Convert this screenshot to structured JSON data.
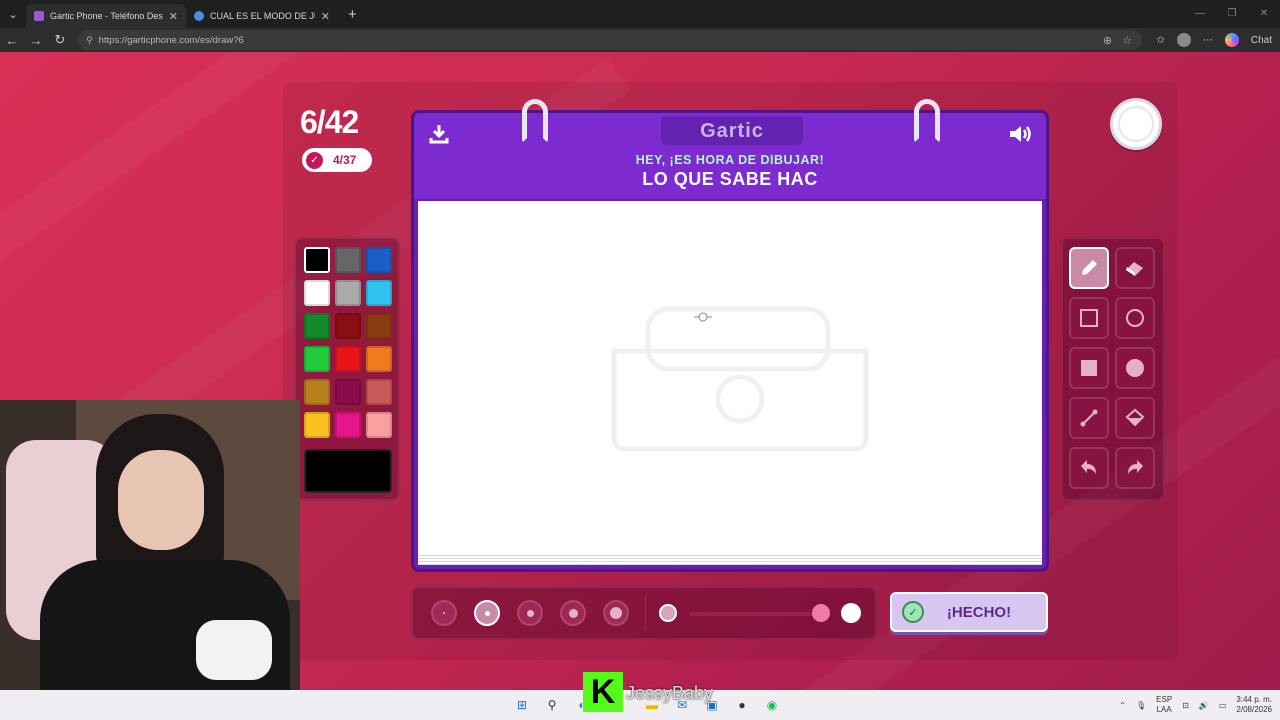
{
  "browser": {
    "tabs": [
      {
        "title": "Gartic Phone - Teléfono Descomp",
        "favicon_color": "#9b59d0",
        "active": true
      },
      {
        "title": "CUAL ES EL MODO DE JUEGO MA",
        "favicon_color": "#4a8fe0",
        "active": false
      }
    ],
    "url": "https://garticphone.com/es/draw?6",
    "chat_label": "Chat"
  },
  "game": {
    "round_counter": "6/42",
    "done_count": "4/37",
    "logo_text": "Gartic",
    "prompt_header": "HEY, ¡ES HORA DE DIBUJAR!",
    "prompt_text": "LO QUE SABE HAC",
    "done_button_label": "¡HECHO!",
    "palette": [
      "#000000",
      "#666666",
      "#1a5fc8",
      "#ffffff",
      "#aaaaaa",
      "#2fc4f0",
      "#138a2a",
      "#8a0e0e",
      "#8a3c10",
      "#1fcc3c",
      "#e8141c",
      "#f07a20",
      "#b8801c",
      "#8a0a4a",
      "#c85a5a",
      "#f8c021",
      "#e8148a",
      "#f8a0a0"
    ],
    "selected_color": "#000000",
    "tools": [
      "pencil-tool",
      "eraser-tool",
      "rectangle-outline-tool",
      "circle-outline-tool",
      "rectangle-fill-tool",
      "circle-fill-tool",
      "line-tool",
      "fill-bucket-tool",
      "undo-tool",
      "redo-tool"
    ],
    "active_tool": "pencil-tool",
    "brush_sizes": 5,
    "selected_brush_index": 1
  },
  "stream": {
    "kick_letter": "K",
    "streamer_name": "JessyBaby"
  },
  "taskbar": {
    "lang_top": "ESP",
    "lang_bottom": "LAA",
    "time": "3:44 p. m.",
    "date": "2/08/2026"
  }
}
